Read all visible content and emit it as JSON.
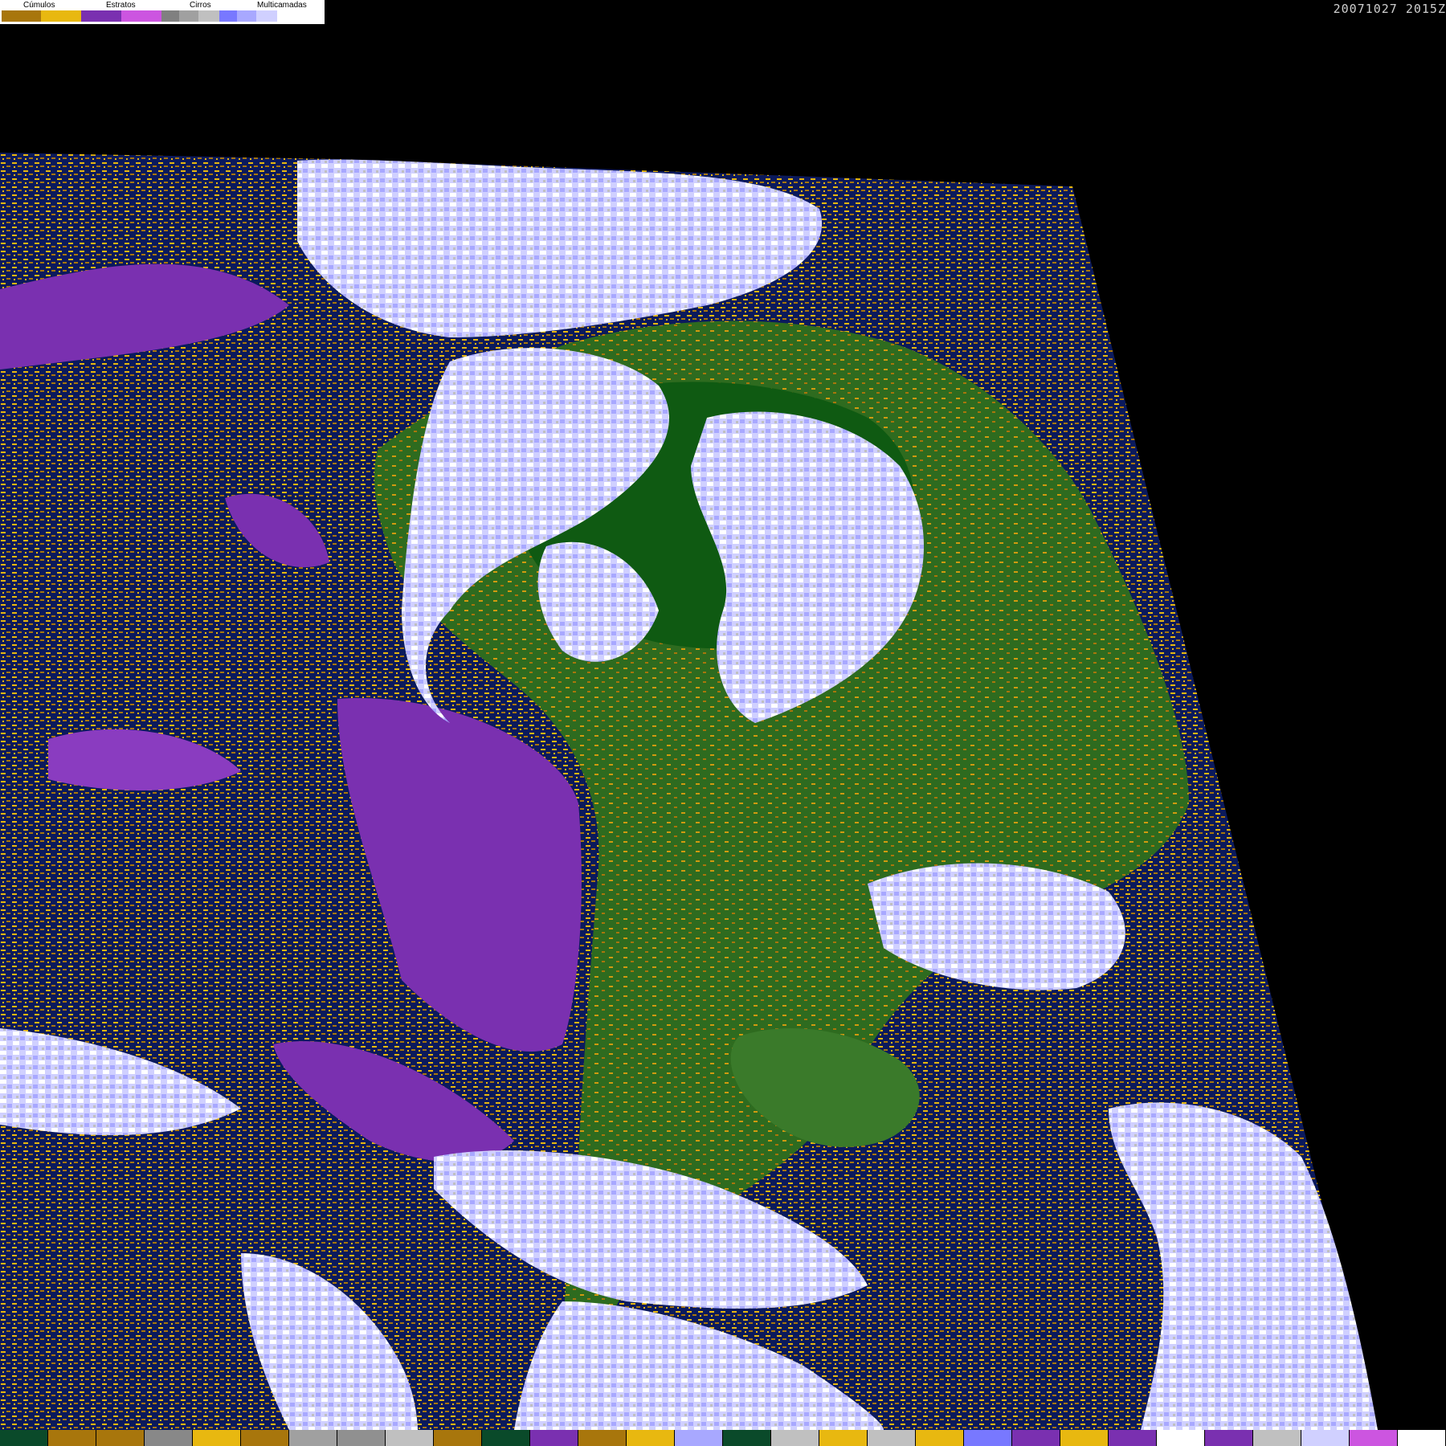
{
  "legend": {
    "labels": [
      "Cúmulos",
      "Estratos",
      "Cirros",
      "Multicamadas"
    ],
    "swatches": [
      "#a8760c",
      "#e8b810",
      "#7a30b0",
      "#cc55e0",
      "#808080",
      "#a0a0a0",
      "#c0c0c0",
      "#7878ff",
      "#a8a8ff",
      "#d0d0ff",
      "#ffffff"
    ]
  },
  "timestamp": "20071027 2015Z",
  "map": {
    "ocean_color": "#0b1a5c",
    "land_color": "#2e6b1f",
    "dense_land_color": "#0f5a12"
  },
  "bottom_bar": {
    "colors": [
      "#0a4a2a",
      "#a8760c",
      "#a8760c",
      "#888888",
      "#e8b810",
      "#a8760c",
      "#a0a0a0",
      "#909090",
      "#c0c0c0",
      "#a8760c",
      "#0a4a2a",
      "#7a30b0",
      "#a8760c",
      "#e8b810",
      "#a8a8ff",
      "#0a4a2a",
      "#c0c0c0",
      "#e8b810",
      "#c0c0c0",
      "#e8b810",
      "#7878ff",
      "#7a30b0",
      "#e8b810",
      "#7a30b0",
      "#ffffff",
      "#7a30b0",
      "#c0c0c0",
      "#d0d0ff",
      "#cc55e0",
      "#ffffff"
    ]
  }
}
